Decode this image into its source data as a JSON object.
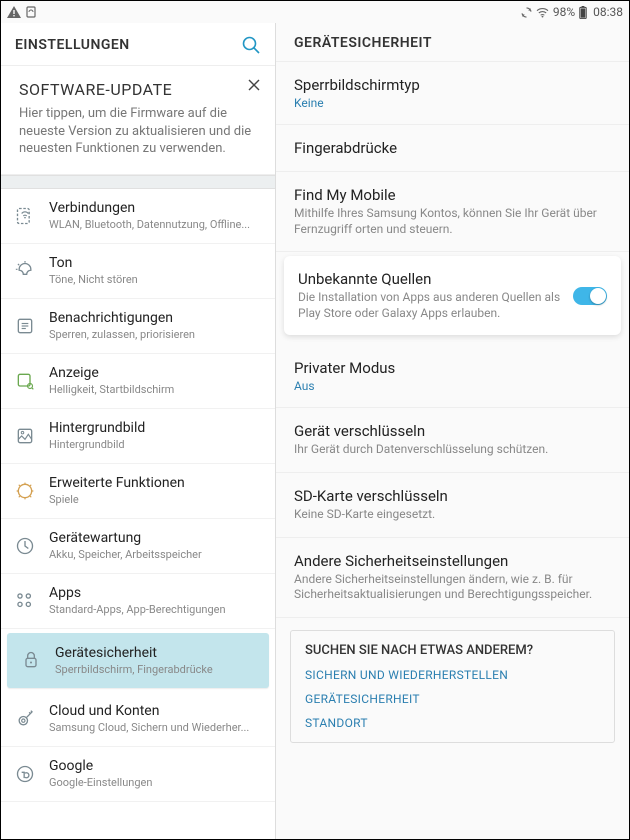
{
  "statusbar": {
    "battery": "98%",
    "time": "08:38"
  },
  "left": {
    "title": "EINSTELLUNGEN",
    "promo_title": "SOFTWARE-UPDATE",
    "promo_desc": "Hier tippen, um die Firmware auf die neueste Version zu aktualisieren und die neuesten Funktionen zu verwenden."
  },
  "items": [
    {
      "label": "Verbindungen",
      "sub": "WLAN, Bluetooth, Datennutzung, Offline..."
    },
    {
      "label": "Ton",
      "sub": "Töne, Nicht stören"
    },
    {
      "label": "Benachrichtigungen",
      "sub": "Sperren, zulassen, priorisieren"
    },
    {
      "label": "Anzeige",
      "sub": "Helligkeit, Startbildschirm"
    },
    {
      "label": "Hintergrundbild",
      "sub": "Hintergrundbild"
    },
    {
      "label": "Erweiterte Funktionen",
      "sub": "Spiele"
    },
    {
      "label": "Gerätewartung",
      "sub": "Akku, Speicher, Arbeitsspeicher"
    },
    {
      "label": "Apps",
      "sub": "Standard-Apps, App-Berechtigungen"
    },
    {
      "label": "Gerätesicherheit",
      "sub": "Sperrbildschirm, Fingerabdrücke"
    },
    {
      "label": "Cloud und Konten",
      "sub": "Samsung Cloud, Sichern und Wiederher..."
    },
    {
      "label": "Google",
      "sub": "Google-Einstellungen"
    }
  ],
  "right": {
    "title": "GERÄTESICHERHEIT"
  },
  "rentries": [
    {
      "label": "Sperrbildschirmtyp",
      "val": "Keine"
    },
    {
      "label": "Fingerabdrücke"
    },
    {
      "label": "Find My Mobile",
      "sub": "Mithilfe Ihres Samsung Kontos, können Sie Ihr Gerät über Fernzugriff orten und steuern."
    },
    {
      "label": "Unbekannte Quellen",
      "sub": "Die Installation von Apps aus anderen Quellen als Play Store oder Galaxy Apps erlauben.",
      "highlight": true,
      "toggle": true
    },
    {
      "label": "Privater Modus",
      "val": "Aus"
    },
    {
      "label": "Gerät verschlüsseln",
      "sub": "Ihr Gerät durch Datenverschlüsselung schützen."
    },
    {
      "label": "SD-Karte verschlüsseln",
      "sub": "Keine SD-Karte eingesetzt."
    },
    {
      "label": "Andere Sicherheitseinstellungen",
      "sub": "Andere Sicherheitseinstellungen ändern, wie z. B. für Sicherheitsaktualisierungen und Berechtigungsspeicher."
    }
  ],
  "search": {
    "q": "SUCHEN SIE NACH ETWAS ANDEREM?",
    "links": [
      "SICHERN UND WIEDERHERSTELLEN",
      "GERÄTESICHERHEIT",
      "STANDORT"
    ]
  }
}
